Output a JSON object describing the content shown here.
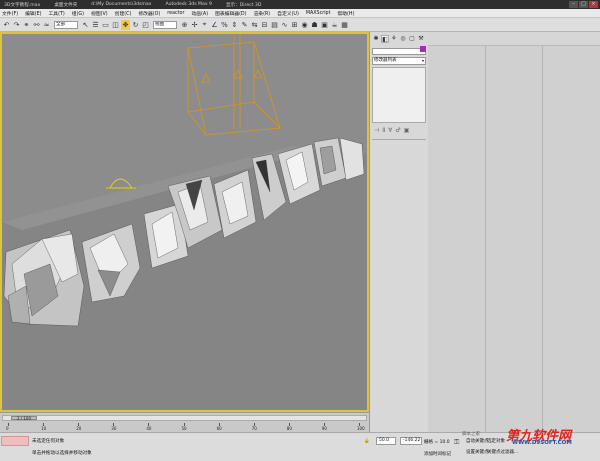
{
  "titlebar": {
    "items": [
      "3D文字教程.max",
      "桌面文件夹",
      "d:\\My Documents\\3dsmax",
      "Autodesk 3ds Max 9",
      "显示：Direct 3D"
    ],
    "buttons": [
      "–",
      "□",
      "×"
    ]
  },
  "menubar": {
    "items": [
      "文件(F)",
      "编辑(E)",
      "工具(T)",
      "组(G)",
      "视图(V)",
      "创建(C)",
      "修改器(O)",
      "reactor",
      "动画(A)",
      "图表编辑器(D)",
      "渲染(R)",
      "自定义(U)",
      "MAXScript",
      "帮助(H)"
    ]
  },
  "toolbar": {
    "selection_set": "全部",
    "view_dropdown": "视图"
  },
  "viewport": {
    "label": ""
  },
  "command_panel": {
    "modifier_list": "修改器列表"
  },
  "timeline": {
    "frame_indicator": "2 / 100",
    "ticks": [
      "0",
      "10",
      "20",
      "30",
      "40",
      "50",
      "60",
      "70",
      "80",
      "90",
      "100"
    ]
  },
  "statusbar": {
    "message1": "未选定任何对象",
    "message2": "单击并拖动以选择并移动对象",
    "x_value": "50.0",
    "y_value": "-146.22",
    "grid_label": "栅格 = 10.0",
    "autokey_label": "自动关键点",
    "selected_label": "选定对象",
    "setkey_label": "设置关键点",
    "keyfilter_label": "关键点过滤器...",
    "addtime_label": "添加时间标记"
  },
  "watermark": {
    "brand": "第九软件网",
    "url": "WWW.D9SOFT.COM",
    "small": "脚本之家"
  }
}
